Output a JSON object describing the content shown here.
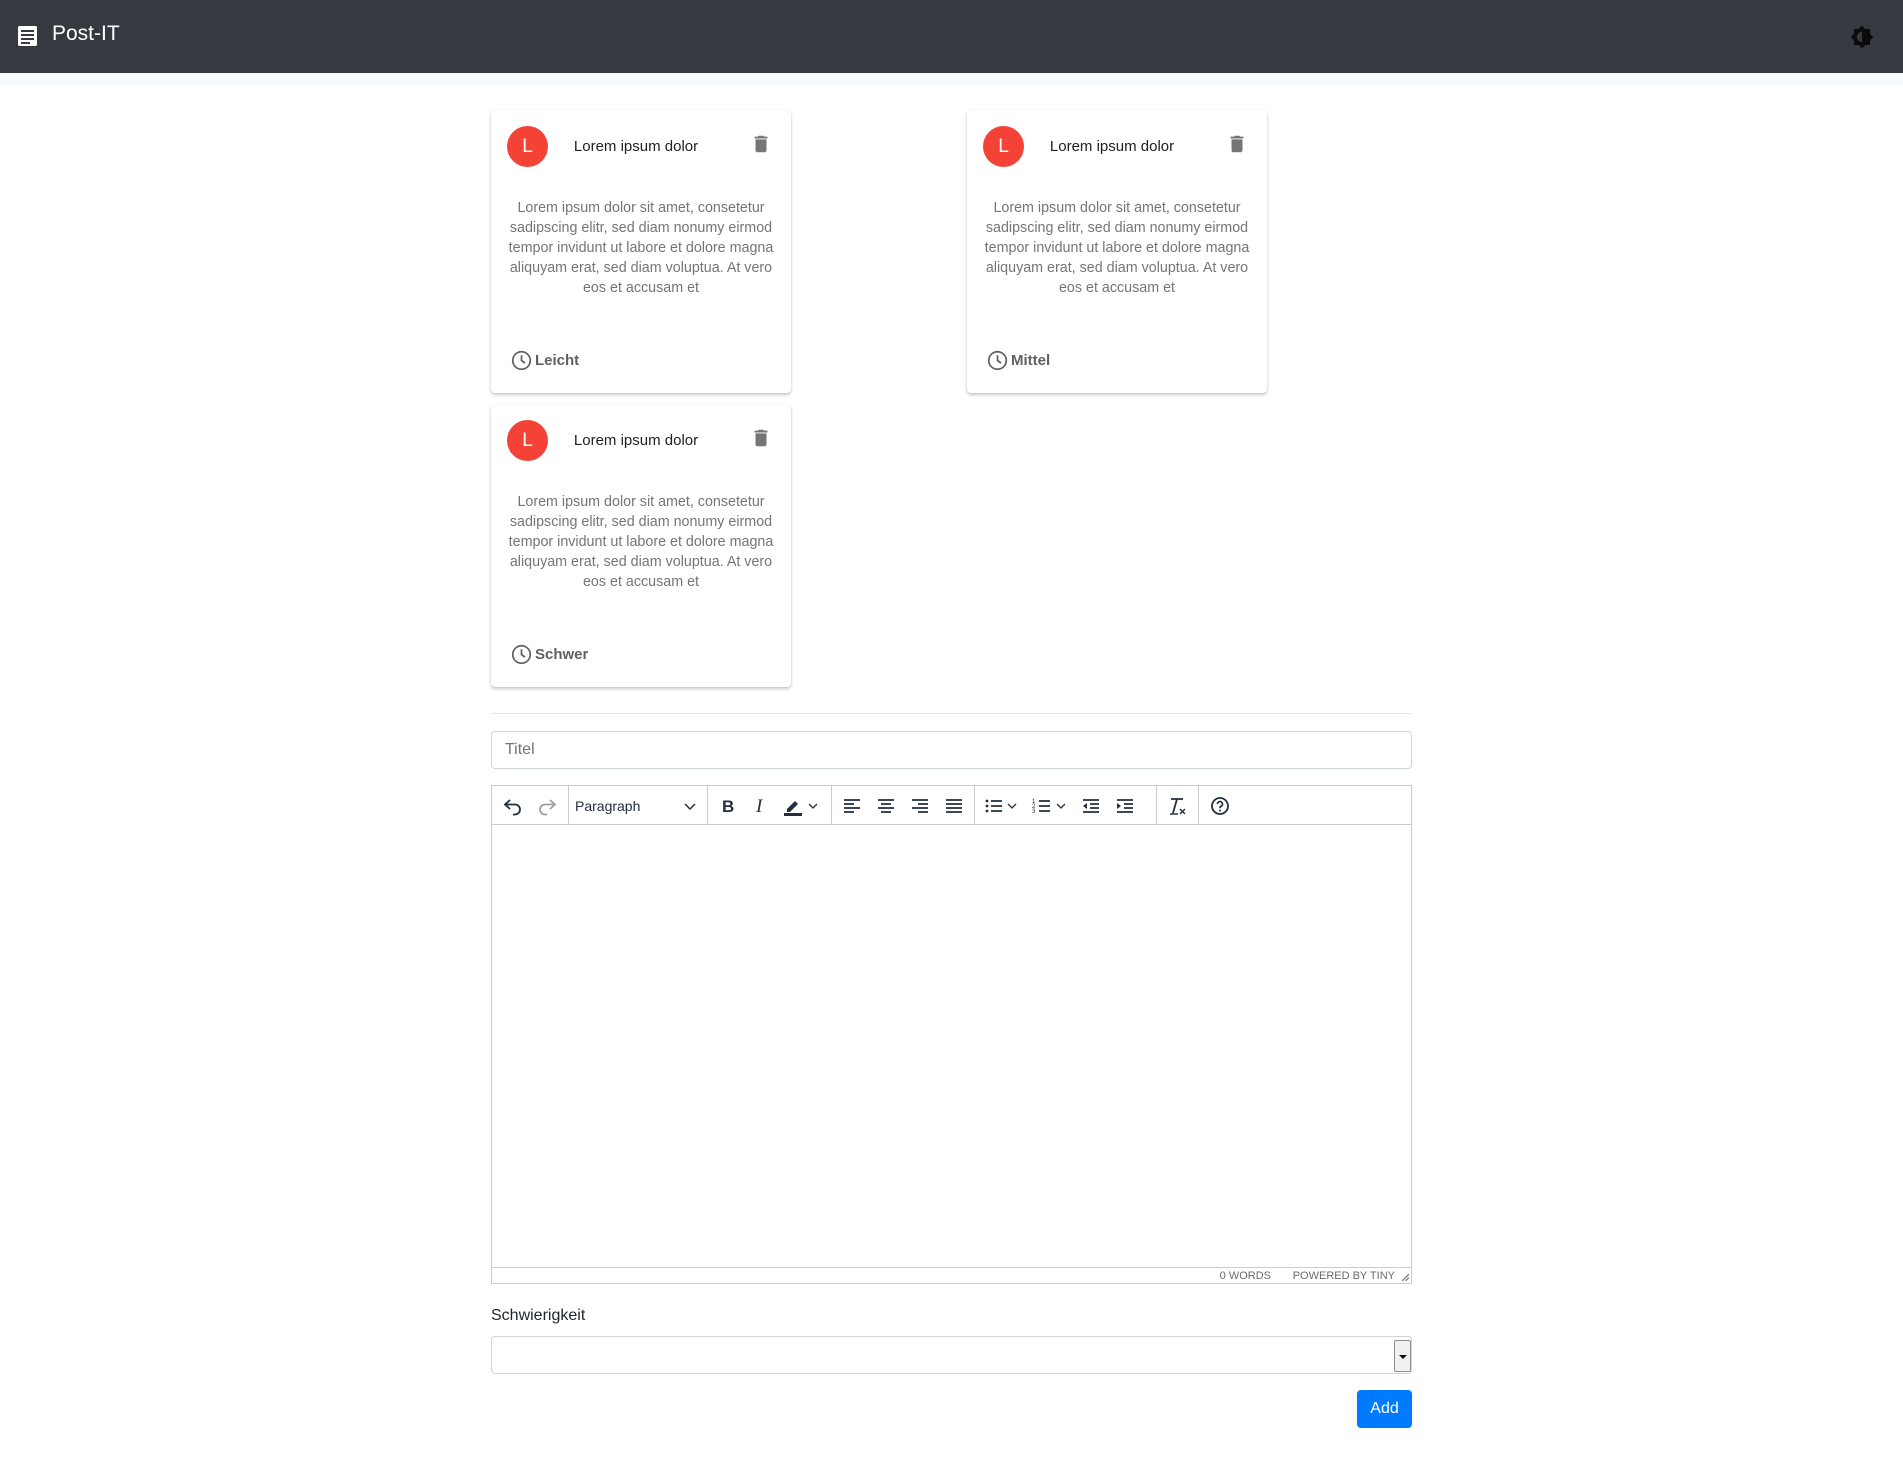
{
  "navbar": {
    "title": "Post-IT",
    "brand_icon": "notes-icon",
    "theme_icon": "brightness-icon"
  },
  "cards": [
    {
      "avatar_letter": "L",
      "title": "Lorem ipsum dolor",
      "body": "Lorem ipsum dolor sit amet, consetetur sadipscing elitr, sed diam nonumy eirmod tempor invidunt ut labore et dolore magna aliquyam erat, sed diam voluptua. At vero eos et accusam et",
      "level": "Leicht"
    },
    {
      "avatar_letter": "L",
      "title": "Lorem ipsum dolor",
      "body": "Lorem ipsum dolor sit amet, consetetur sadipscing elitr, sed diam nonumy eirmod tempor invidunt ut labore et dolore magna aliquyam erat, sed diam voluptua. At vero eos et accusam et",
      "level": "Mittel"
    },
    {
      "avatar_letter": "L",
      "title": "Lorem ipsum dolor",
      "body": "Lorem ipsum dolor sit amet, consetetur sadipscing elitr, sed diam nonumy eirmod tempor invidunt ut labore et dolore magna aliquyam erat, sed diam voluptua. At vero eos et accusam et",
      "level": "Schwer"
    }
  ],
  "form": {
    "title_placeholder": "Titel",
    "editor": {
      "block_format": "Paragraph",
      "word_count": "0 WORDS",
      "powered_by": "POWERED BY TINY"
    },
    "difficulty_label": "Schwierigkeit",
    "difficulty_value": "",
    "add_label": "Add"
  },
  "colors": {
    "navbar": "#343a40",
    "avatar": "#f44336",
    "primary": "#007bff"
  }
}
